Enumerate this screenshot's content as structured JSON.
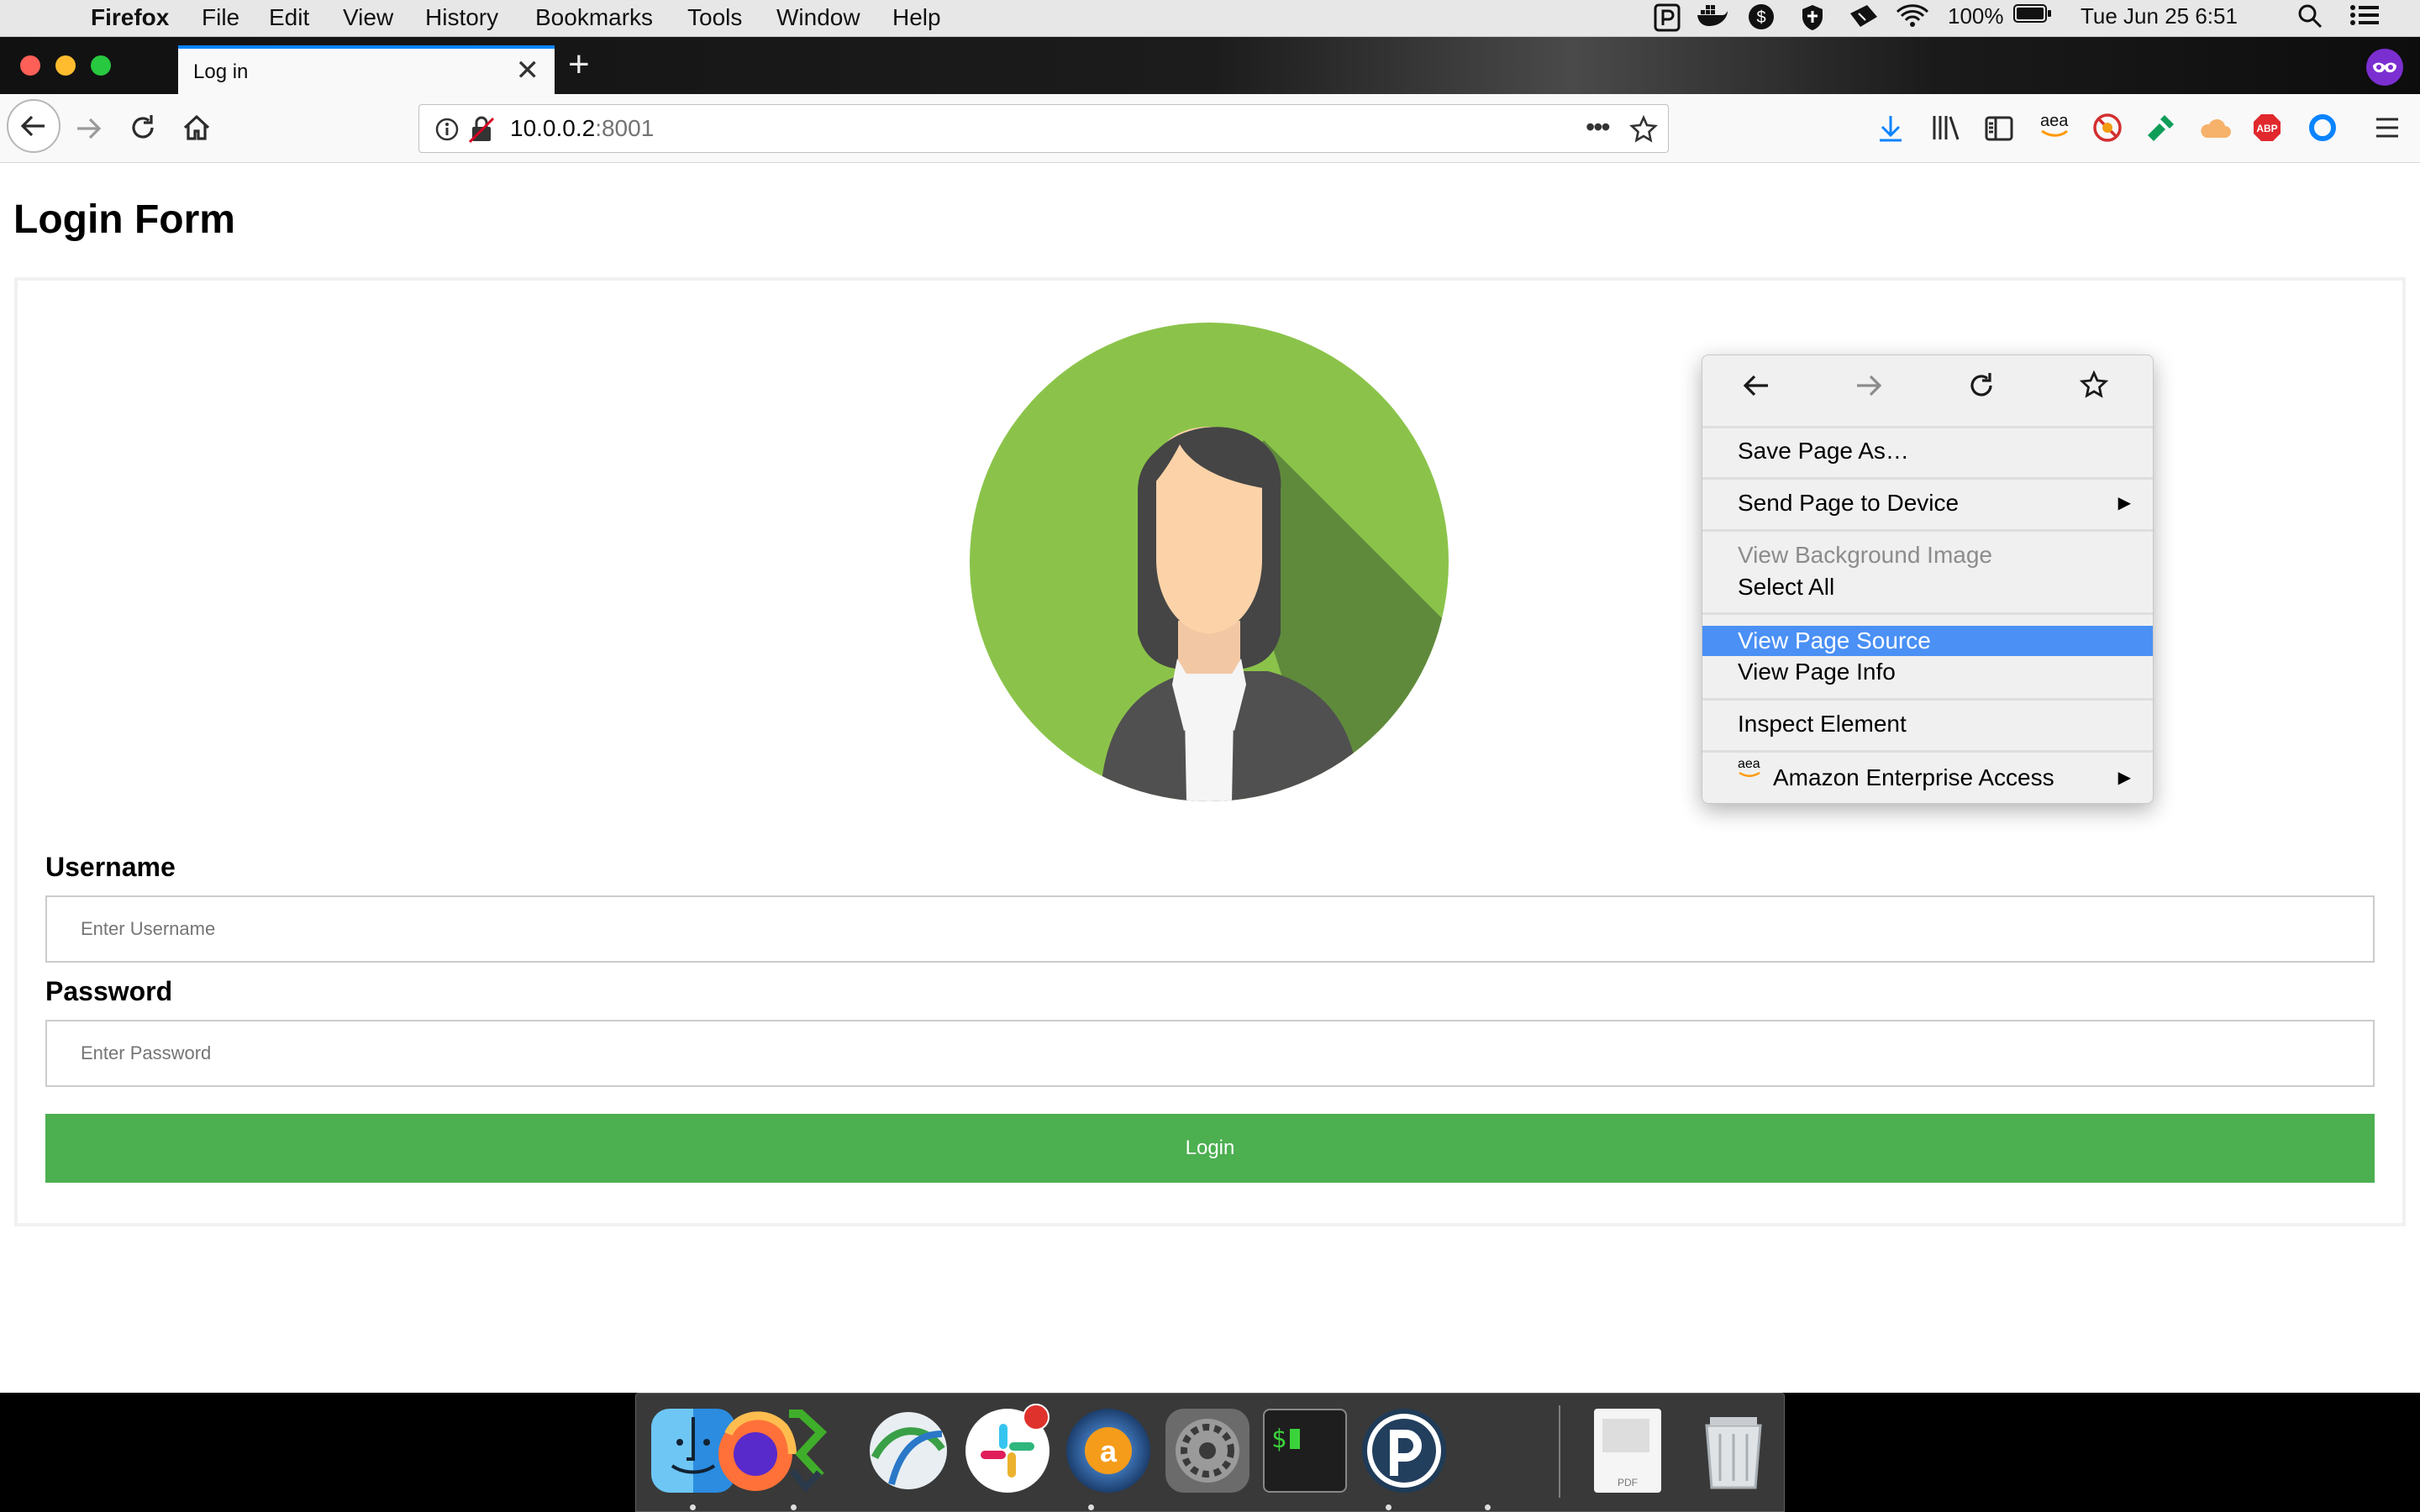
{
  "menubar": {
    "app_name": "Firefox",
    "menus": [
      "File",
      "Edit",
      "View",
      "History",
      "Bookmarks",
      "Tools",
      "Window",
      "Help"
    ],
    "battery": "100%",
    "clock": "Tue Jun 25  6:51"
  },
  "tab": {
    "title": "Log in",
    "close": "✕"
  },
  "url": {
    "host": "10.0.0.2",
    "port": ":8001"
  },
  "page": {
    "title": "Login Form",
    "username_label": "Username",
    "username_placeholder": "Enter Username",
    "password_label": "Password",
    "password_placeholder": "Enter Password",
    "login_button": "Login"
  },
  "context_menu": {
    "items": [
      "Save Page As…",
      "Send Page to Device",
      "View Background Image",
      "Select All",
      "View Page Source",
      "View Page Info",
      "Inspect Element",
      "Amazon Enterprise Access"
    ],
    "highlighted": "View Page Source",
    "disabled": [
      "View Background Image"
    ]
  },
  "toolbar_icons": [
    "download-icon",
    "library-icon",
    "sidebar-icon",
    "aea-icon",
    "blocked-icon",
    "dropper-icon",
    "cloud-icon",
    "abp-icon",
    "circle-icon",
    "menu-icon"
  ],
  "colors": {
    "accent": "#0a84ff",
    "login_green": "#4caf50",
    "avatar_green": "#8bc34a",
    "highlight": "#4a90f5"
  },
  "aea_badge": "aea",
  "abp_badge": "ABP",
  "dock": {
    "apps": [
      "Finder",
      "Firefox",
      "Sourcetree",
      "Cisco AnyConnect",
      "Slack",
      "Amazon Assistant",
      "System Preferences",
      "Terminal",
      "Pocket Casts",
      "PDF document",
      "Trash"
    ],
    "pdf_label": "PDF"
  }
}
